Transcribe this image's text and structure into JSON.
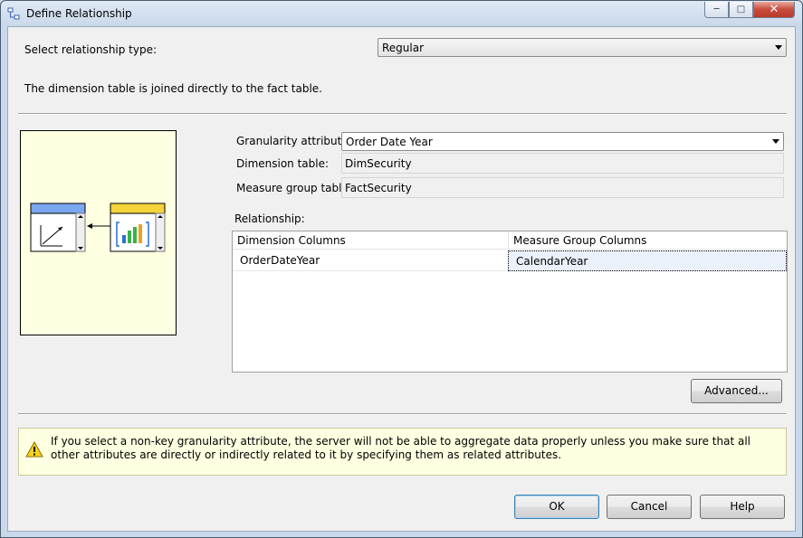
{
  "window": {
    "title": "Define Relationship",
    "icon": "relationship-icon"
  },
  "controls": {
    "minimize": "minimize-icon",
    "maximize": "maximize-icon",
    "close": "close-icon"
  },
  "relationship_type": {
    "label": "Select relationship type:",
    "value": "Regular"
  },
  "description": "The dimension table is joined directly to the fact table.",
  "granularity": {
    "label": "Granularity attribute:",
    "value": "Order Date Year"
  },
  "dimension_table": {
    "label": "Dimension table:",
    "value": "DimSecurity"
  },
  "measure_group_table": {
    "label": "Measure group table:",
    "value": "FactSecurity"
  },
  "relationship": {
    "label": "Relationship:",
    "columns": [
      "Dimension Columns",
      "Measure Group Columns"
    ],
    "rows": [
      [
        "OrderDateYear",
        "CalendarYear"
      ]
    ]
  },
  "buttons": {
    "advanced": "Advanced...",
    "ok": "OK",
    "cancel": "Cancel",
    "help": "Help"
  },
  "warning": {
    "icon": "warning-icon",
    "text": "If you select a non-key granularity attribute, the server will not be able to aggregate data properly unless you make sure that all other attributes are directly or indirectly related to it by specifying them as related attributes."
  },
  "colors": {
    "diagram_bg": "#ffffe1",
    "dimension_header": "#7aa7f0",
    "fact_header": "#f5d33a"
  }
}
